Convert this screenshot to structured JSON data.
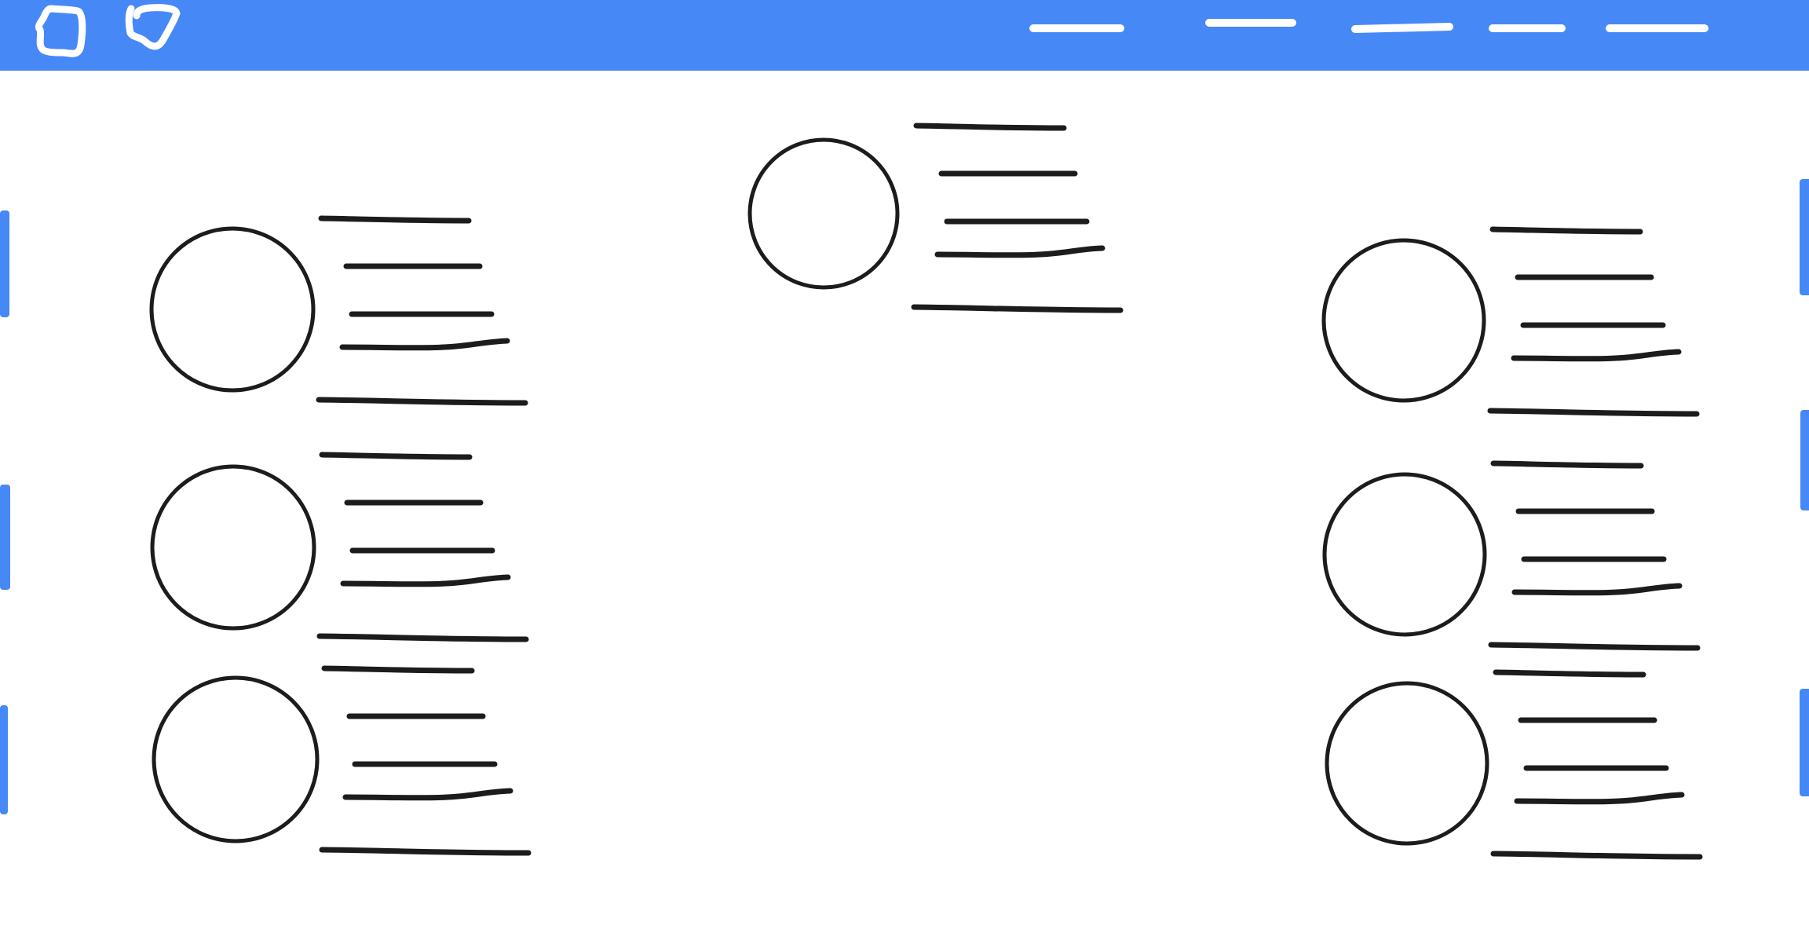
{
  "sketch_title": "",
  "colors": {
    "header": "#4688F6",
    "ink": "#1C1C1C",
    "background": "#FFFFFF"
  },
  "header": {
    "logo_icons": [
      "square-scribble-icon",
      "shield-scribble-icon"
    ],
    "nav_placeholder_count": 5
  },
  "side_tabs": {
    "left_count": 3,
    "right_count": 3
  },
  "cards": [
    {
      "id": "top-center",
      "avatar": "empty-circle",
      "text_lines": 5
    },
    {
      "id": "left-1",
      "avatar": "empty-circle",
      "text_lines": 5
    },
    {
      "id": "left-2",
      "avatar": "empty-circle",
      "text_lines": 5
    },
    {
      "id": "left-3",
      "avatar": "empty-circle",
      "text_lines": 5
    },
    {
      "id": "right-1",
      "avatar": "empty-circle",
      "text_lines": 5
    },
    {
      "id": "right-2",
      "avatar": "empty-circle",
      "text_lines": 5
    },
    {
      "id": "right-3",
      "avatar": "empty-circle",
      "text_lines": 5
    }
  ]
}
